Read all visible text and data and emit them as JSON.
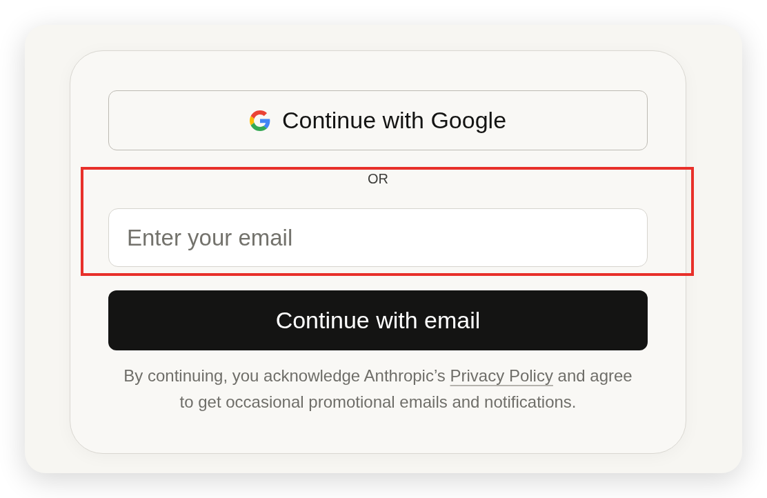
{
  "google_button": {
    "label": "Continue with Google"
  },
  "divider": {
    "label": "OR"
  },
  "email_field": {
    "placeholder": "Enter your email"
  },
  "email_button": {
    "label": "Continue with email"
  },
  "consent": {
    "before": "By continuing, you acknowledge Anthropic’s ",
    "link": "Privacy Policy",
    "after": " and agree to get occasional promotional emails and notifications."
  }
}
